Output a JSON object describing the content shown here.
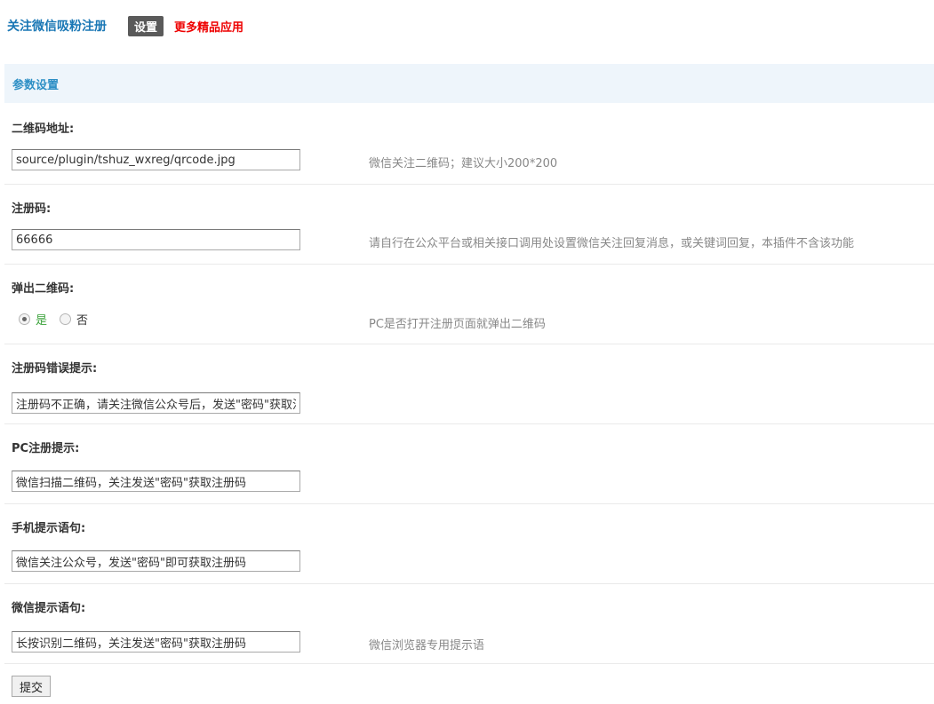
{
  "header": {
    "title": "关注微信吸粉注册",
    "tab_settings": "设置",
    "more_apps": "更多精品应用"
  },
  "section": {
    "title": "参数设置"
  },
  "fields": {
    "qrcode": {
      "label": "二维码地址:",
      "value": "source/plugin/tshuz_wxreg/qrcode.jpg",
      "tip": "微信关注二维码；建议大小200*200"
    },
    "reg_code": {
      "label": "注册码:",
      "value": "66666",
      "tip": "请自行在公众平台或相关接口调用处设置微信关注回复消息，或关键词回复，本插件不含该功能"
    },
    "popup_qrcode": {
      "label": "弹出二维码:",
      "yes": "是",
      "no": "否",
      "selected": "是",
      "tip": "PC是否打开注册页面就弹出二维码"
    },
    "error_tip": {
      "label": "注册码错误提示:",
      "value": "注册码不正确，请关注微信公众号后，发送\"密码\"获取注册码"
    },
    "pc_tip": {
      "label": "PC注册提示:",
      "value": "微信扫描二维码，关注发送\"密码\"获取注册码"
    },
    "mobile_tip": {
      "label": "手机提示语句:",
      "value": "微信关注公众号，发送\"密码\"即可获取注册码"
    },
    "wechat_tip": {
      "label": "微信提示语句:",
      "value": "长按识别二维码，关注发送\"密码\"获取注册码",
      "tip": "微信浏览器专用提示语"
    }
  },
  "submit_label": "提交"
}
